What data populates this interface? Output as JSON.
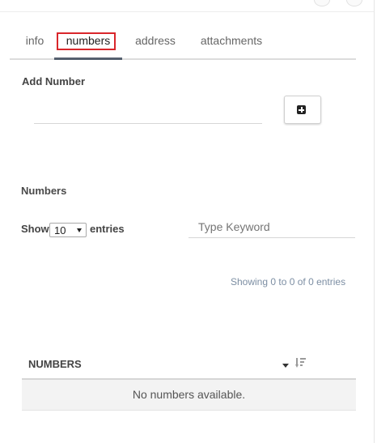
{
  "tabs": [
    {
      "label": "info"
    },
    {
      "label": "numbers"
    },
    {
      "label": "address"
    },
    {
      "label": "attachments"
    }
  ],
  "active_tab": "numbers",
  "add_number": {
    "label": "Add Number",
    "input_value": "",
    "button_icon": "plus-square-icon"
  },
  "numbers_section": {
    "label": "Numbers",
    "show_label": "Show",
    "page_size": "10",
    "entries_label": "entries",
    "search_placeholder": "Type Keyword",
    "info": "Showing 0 to 0 of 0 entries"
  },
  "table": {
    "columns": [
      "NUMBERS"
    ],
    "empty_message": "No numbers available.",
    "icons": [
      "caret-down-icon",
      "sort-icon"
    ]
  },
  "colors": {
    "active_tab_indicator": "#545f6e",
    "focus_outline": "#d9262b",
    "info_text": "#7c8ea3",
    "empty_row_bg": "#f3f3f3"
  }
}
